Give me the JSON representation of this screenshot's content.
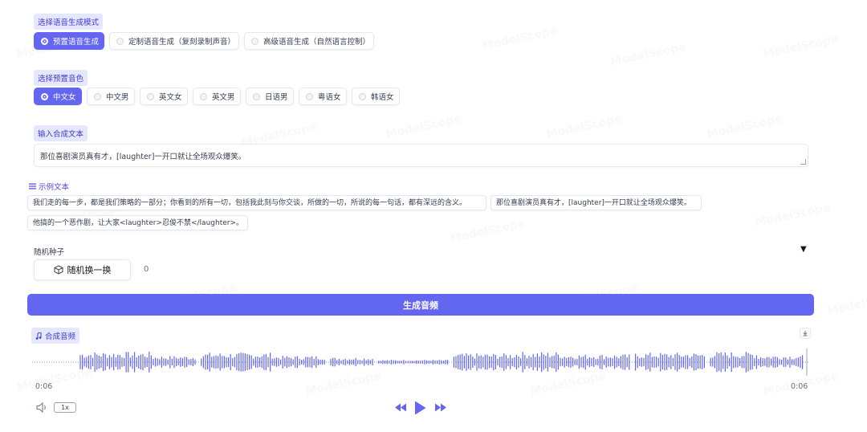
{
  "mode": {
    "section_label": "选择语音生成模式",
    "options": [
      {
        "label": "预置语音生成",
        "selected": true
      },
      {
        "label": "定制语音生成（复刻录制声音）",
        "selected": false
      },
      {
        "label": "高级语音生成（自然语言控制）",
        "selected": false
      }
    ]
  },
  "voice": {
    "section_label": "选择预置音色",
    "options": [
      {
        "label": "中文女",
        "selected": true
      },
      {
        "label": "中文男",
        "selected": false
      },
      {
        "label": "英文女",
        "selected": false
      },
      {
        "label": "英文男",
        "selected": false
      },
      {
        "label": "日语男",
        "selected": false
      },
      {
        "label": "粤语女",
        "selected": false
      },
      {
        "label": "韩语女",
        "selected": false
      }
    ]
  },
  "input": {
    "section_label": "输入合成文本",
    "value": "那位喜剧演员真有才，[laughter]一开口就让全场观众爆笑。"
  },
  "examples": {
    "title": "示例文本",
    "items": [
      "我们走的每一步，都是我们策略的一部分；你看到的所有一切，包括我此刻与你交谈，所做的一切，所说的每一句话，都有深远的含义。",
      "那位喜剧演员真有才，[laughter]一开口就让全场观众爆笑。",
      "他搞的一个恶作剧，让大家<laughter>忍俊不禁</laughter>。"
    ]
  },
  "seed": {
    "label": "随机种子",
    "button_label": "随机换一换",
    "value": "0"
  },
  "generate": {
    "label": "生成音频"
  },
  "audio": {
    "label": "合成音频",
    "current_time": "0:06",
    "total_time": "0:06",
    "speed": "1x"
  },
  "watermark": "ModelScope",
  "colors": {
    "accent": "#6366f1",
    "label_bg": "#e4e7fd",
    "label_text": "#4338ca"
  }
}
